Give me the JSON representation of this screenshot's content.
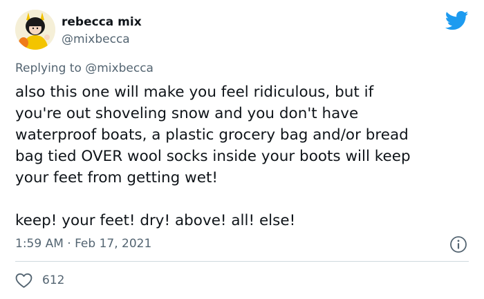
{
  "tweet": {
    "author": {
      "display_name": "rebecca mix",
      "handle": "@mixbecca",
      "avatar": "user-avatar-cartoon"
    },
    "brand_icon": "twitter-bird-icon",
    "brand_color": "#1d9bf0",
    "reply_context": {
      "prefix": "Replying to ",
      "mention": "@mixbecca"
    },
    "text_lines": [
      "also this one will make you feel ridiculous, but if",
      "you're out shoveling snow and you don't have",
      "waterproof boats, a plastic grocery bag and/or bread",
      "bag tied OVER wool socks inside your boots will keep",
      "your feet from getting wet!",
      "",
      "keep! your feet! dry! above! all! else!"
    ],
    "timestamp": "1:59 AM · Feb 17, 2021",
    "info_icon": "info-icon",
    "likes": {
      "icon": "heart-icon",
      "count": "612"
    }
  }
}
